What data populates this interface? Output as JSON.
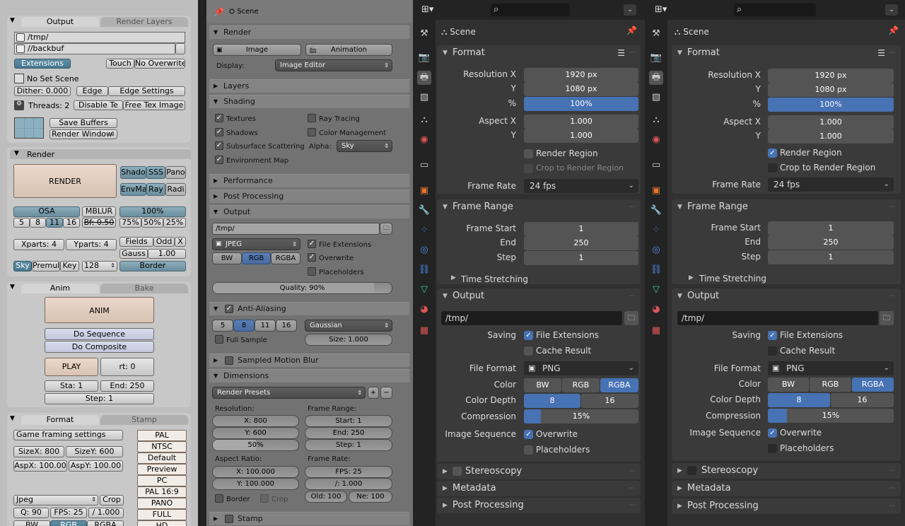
{
  "p1": {
    "output_tab": "Output",
    "render_layers_tab": "Render Layers",
    "path1": "/tmp/",
    "path2": "//backbuf",
    "extensions": "Extensions",
    "touch": "Touch",
    "no_overwrite": "No Overwrite",
    "no_set_scene": "No Set Scene",
    "dither": "Dither: 0.000",
    "edge": "Edge",
    "edge_settings": "Edge Settings",
    "threads": "Threads: 2",
    "disable_te": "Disable Te",
    "free_tex_image": "Free Tex Image",
    "save_buffers": "Save Buffers",
    "render_window": "Render Window",
    "render_panel": "Render",
    "render_button": "RENDER",
    "shado": "Shado",
    "sss": "SSS",
    "pano": "Pano",
    "envma": "EnvMa",
    "ray": "Ray",
    "radi": "Radi",
    "osa": "OSA",
    "mblur": "MBLUR",
    "pct100": "100%",
    "osa_values": [
      "5",
      "8",
      "11",
      "16"
    ],
    "bf": "Bf: 0.50",
    "pcts": [
      "75%",
      "50%",
      "25%"
    ],
    "xparts": "Xparts: 4",
    "yparts": "Yparts: 4",
    "fields": "Fields",
    "odd": "Odd",
    "x": "X",
    "gauss": "Gauss",
    "gauss_val": "1.00",
    "sky": "Sky",
    "premul": "Premul",
    "key": "Key",
    "val128": "128",
    "border": "Border",
    "anim_tab": "Anim",
    "bake_tab": "Bake",
    "anim_button": "ANIM",
    "do_sequence": "Do Sequence",
    "do_composite": "Do Composite",
    "play": "PLAY",
    "rt": "rt: 0",
    "sta": "Sta: 1",
    "end": "End: 250",
    "step": "Step: 1",
    "format_tab": "Format",
    "stamp_tab": "Stamp",
    "game_framing": "Game framing settings",
    "sizex": "SizeX: 800",
    "sizey": "SizeY: 600",
    "aspx": "AspX: 100.00",
    "aspy": "AspY: 100.00",
    "presets": [
      "PAL",
      "NTSC",
      "Default",
      "Preview",
      "PC",
      "PAL 16:9",
      "PANO",
      "FULL",
      "HD"
    ],
    "jpeg": "Jpeg",
    "crop": "Crop",
    "q": "Q: 90",
    "fps": "FPS: 25",
    "fps_base": "/ 1.000",
    "bw": "BW",
    "rgb": "RGB",
    "rgba": "RGBA"
  },
  "p2": {
    "header": "Scene",
    "render": "Render",
    "image": "Image",
    "animation": "Animation",
    "display_label": "Display:",
    "display_value": "Image Editor",
    "layers": "Layers",
    "shading": "Shading",
    "textures": "Textures",
    "ray_tracing": "Ray Tracing",
    "shadows": "Shadows",
    "color_management": "Color Management",
    "subsurface": "Subsurface Scattering",
    "alpha_label": "Alpha:",
    "alpha_value": "Sky",
    "environment_map": "Environment Map",
    "performance": "Performance",
    "post_processing": "Post Processing",
    "output": "Output",
    "path": "/tmp/",
    "format": "JPEG",
    "file_extensions": "File Extensions",
    "overwrite": "Overwrite",
    "placeholders": "Placeholders",
    "bw": "BW",
    "rgb": "RGB",
    "rgba": "RGBA",
    "quality": "Quality: 90%",
    "quality_value": 0.9,
    "anti_aliasing": "Anti-Aliasing",
    "aa_values": [
      "5",
      "8",
      "11",
      "16"
    ],
    "filter": "Gaussian",
    "full_sample": "Full Sample",
    "size": "Size: 1.000",
    "sampled_motion_blur": "Sampled Motion Blur",
    "dimensions": "Dimensions",
    "render_presets": "Render Presets",
    "resolution": "Resolution:",
    "res_x": "X: 800",
    "res_y": "Y: 600",
    "res_pct": "50%",
    "res_pct_value": 0.5,
    "frame_range": "Frame Range:",
    "start": "Start: 1",
    "end": "End: 250",
    "step": "Step: 1",
    "aspect_ratio": "Aspect Ratio:",
    "asp_x": "X: 100.000",
    "asp_y": "Y: 100.000",
    "frame_rate": "Frame Rate:",
    "fps": "FPS: 25",
    "fps_base": "/: 1.000",
    "border": "Border",
    "crop": "Crop",
    "old": "Old: 100",
    "new": "Ne: 100",
    "stamp": "Stamp"
  },
  "p3": {
    "scene": "Scene",
    "format": "Format",
    "resolution_x_label": "Resolution X",
    "y_label": "Y",
    "pct_label": "%",
    "res_x": "1920 px",
    "res_y": "1080 px",
    "res_pct": "100%",
    "aspect_x_label": "Aspect X",
    "aspect_x": "1.000",
    "aspect_y": "1.000",
    "render_region": "Render Region",
    "crop_to_render_region": "Crop to Render Region",
    "frame_rate_label": "Frame Rate",
    "frame_rate": "24 fps",
    "frame_range": "Frame Range",
    "frame_start_label": "Frame Start",
    "end_label": "End",
    "step_label": "Step",
    "frame_start": "1",
    "frame_end": "250",
    "frame_step": "1",
    "time_stretching": "Time Stretching",
    "output": "Output",
    "path": "/tmp/",
    "saving_label": "Saving",
    "file_extensions": "File Extensions",
    "cache_result": "Cache Result",
    "file_format_label": "File Format",
    "file_format": "PNG",
    "color_label": "Color",
    "bw": "BW",
    "rgb": "RGB",
    "rgba": "RGBA",
    "color_depth_label": "Color Depth",
    "depth8": "8",
    "depth16": "16",
    "compression_label": "Compression",
    "compression": "15%",
    "compression_value": 0.15,
    "image_sequence_label": "Image Sequence",
    "overwrite": "Overwrite",
    "placeholders": "Placeholders",
    "stereoscopy": "Stereoscopy",
    "metadata": "Metadata",
    "post_processing": "Post Processing"
  }
}
